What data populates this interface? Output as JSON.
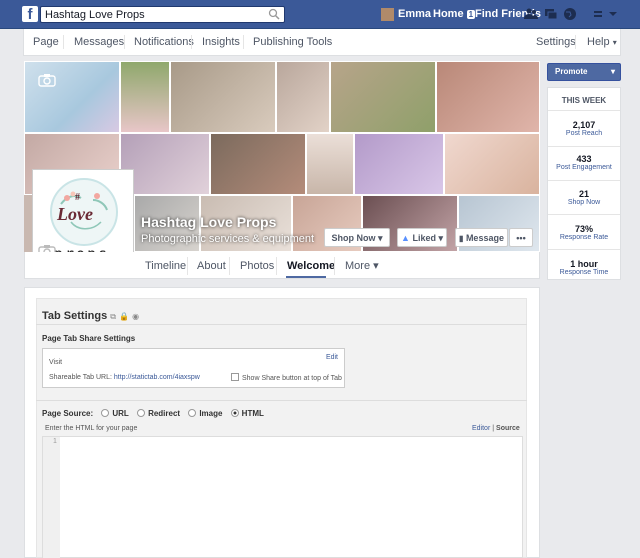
{
  "topbar": {
    "logo": "f",
    "search_value": "Hashtag Love Props",
    "user_name": "Emma",
    "home_label": "Home",
    "home_badge": "1",
    "find_friends": "Find Friends"
  },
  "subnav": {
    "items": [
      "Page",
      "Messages",
      "Notifications",
      "Insights",
      "Publishing Tools"
    ],
    "settings": "Settings",
    "help": "Help",
    "help_caret": "▾"
  },
  "cover": {
    "page_name": "Hashtag Love Props",
    "category": "Photographic services & equipment",
    "shop_now": "Shop Now ▾",
    "liked": "Liked ▾",
    "message": "Message",
    "more": "•••"
  },
  "profile": {
    "logo_hash": "#",
    "logo_love": "Love",
    "logo_props": "props"
  },
  "tabs": {
    "timeline": "Timeline",
    "about": "About",
    "photos": "Photos",
    "welcome": "Welcome",
    "more": "More ▾"
  },
  "app": {
    "title": "Tab Settings",
    "share_settings": "Page Tab Share Settings",
    "visit": "Visit",
    "edit": "Edit",
    "share_url_label": "Shareable Tab URL:",
    "share_url": "http://statictab.com/4iaxspw",
    "show_share": "Show Share button at top of Tab",
    "page_source": "Page Source:",
    "src_url": "URL",
    "src_redirect": "Redirect",
    "src_image": "Image",
    "src_html": "HTML",
    "html_prompt": "Enter the HTML for your page",
    "editor_link": "Editor",
    "sep": "|",
    "source_link": "Source",
    "line_no": "1"
  },
  "sidebar": {
    "promote": "Promote",
    "promote_caret": "▾",
    "heading": "THIS WEEK",
    "stats": [
      {
        "value": "2,107",
        "label": "Post Reach"
      },
      {
        "value": "433",
        "label": "Post Engagement"
      },
      {
        "value": "21",
        "label": "Shop Now"
      },
      {
        "value": "73%",
        "label": "Response Rate"
      },
      {
        "value": "1 hour",
        "label": "Response Time"
      }
    ]
  },
  "colors": {
    "brand": "#3b5998",
    "accent": "#4e69a2"
  }
}
